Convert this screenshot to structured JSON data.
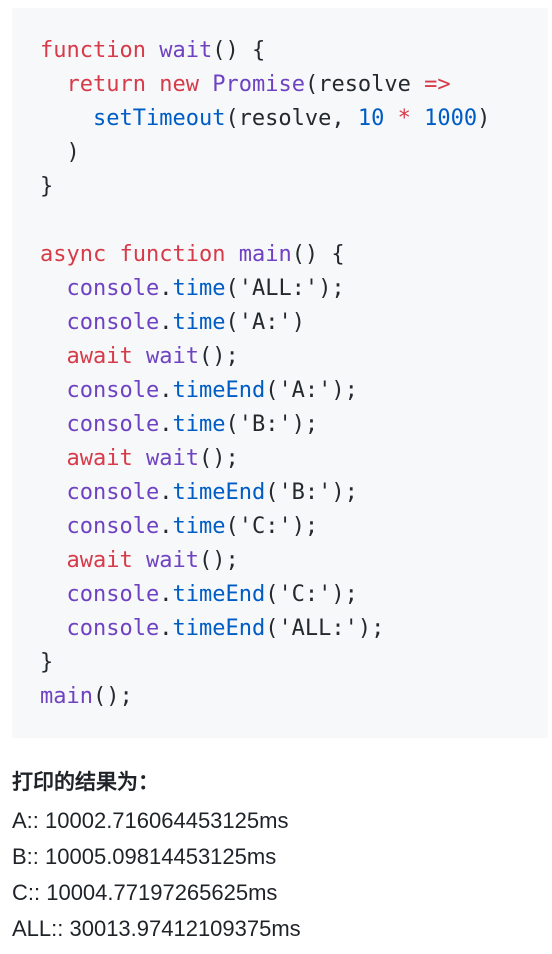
{
  "code": {
    "lines": [
      [
        [
          "kw",
          "function"
        ],
        [
          "plain",
          " "
        ],
        [
          "fn",
          "wait"
        ],
        [
          "plain",
          "() {"
        ]
      ],
      [
        [
          "plain",
          "  "
        ],
        [
          "kw",
          "return"
        ],
        [
          "plain",
          " "
        ],
        [
          "kw",
          "new"
        ],
        [
          "plain",
          " "
        ],
        [
          "fn",
          "Promise"
        ],
        [
          "plain",
          "(resolve "
        ],
        [
          "kw",
          "=>"
        ]
      ],
      [
        [
          "plain",
          "    "
        ],
        [
          "prop",
          "setTimeout"
        ],
        [
          "plain",
          "(resolve, "
        ],
        [
          "num",
          "10"
        ],
        [
          "plain",
          " "
        ],
        [
          "kw",
          "*"
        ],
        [
          "plain",
          " "
        ],
        [
          "num",
          "1000"
        ],
        [
          "plain",
          ")"
        ]
      ],
      [
        [
          "plain",
          "  )"
        ]
      ],
      [
        [
          "plain",
          "}"
        ]
      ],
      [],
      [
        [
          "kw",
          "async"
        ],
        [
          "plain",
          " "
        ],
        [
          "kw",
          "function"
        ],
        [
          "plain",
          " "
        ],
        [
          "fn",
          "main"
        ],
        [
          "plain",
          "() {"
        ]
      ],
      [
        [
          "plain",
          "  "
        ],
        [
          "obj",
          "console"
        ],
        [
          "plain",
          "."
        ],
        [
          "prop",
          "time"
        ],
        [
          "plain",
          "("
        ],
        [
          "str",
          "'ALL:'"
        ],
        [
          "plain",
          ");"
        ]
      ],
      [
        [
          "plain",
          "  "
        ],
        [
          "obj",
          "console"
        ],
        [
          "plain",
          "."
        ],
        [
          "prop",
          "time"
        ],
        [
          "plain",
          "("
        ],
        [
          "str",
          "'A:'"
        ],
        [
          "plain",
          ")"
        ]
      ],
      [
        [
          "plain",
          "  "
        ],
        [
          "kw",
          "await"
        ],
        [
          "plain",
          " "
        ],
        [
          "fn",
          "wait"
        ],
        [
          "plain",
          "();"
        ]
      ],
      [
        [
          "plain",
          "  "
        ],
        [
          "obj",
          "console"
        ],
        [
          "plain",
          "."
        ],
        [
          "prop",
          "timeEnd"
        ],
        [
          "plain",
          "("
        ],
        [
          "str",
          "'A:'"
        ],
        [
          "plain",
          ");"
        ]
      ],
      [
        [
          "plain",
          "  "
        ],
        [
          "obj",
          "console"
        ],
        [
          "plain",
          "."
        ],
        [
          "prop",
          "time"
        ],
        [
          "plain",
          "("
        ],
        [
          "str",
          "'B:'"
        ],
        [
          "plain",
          ");"
        ]
      ],
      [
        [
          "plain",
          "  "
        ],
        [
          "kw",
          "await"
        ],
        [
          "plain",
          " "
        ],
        [
          "fn",
          "wait"
        ],
        [
          "plain",
          "();"
        ]
      ],
      [
        [
          "plain",
          "  "
        ],
        [
          "obj",
          "console"
        ],
        [
          "plain",
          "."
        ],
        [
          "prop",
          "timeEnd"
        ],
        [
          "plain",
          "("
        ],
        [
          "str",
          "'B:'"
        ],
        [
          "plain",
          ");"
        ]
      ],
      [
        [
          "plain",
          "  "
        ],
        [
          "obj",
          "console"
        ],
        [
          "plain",
          "."
        ],
        [
          "prop",
          "time"
        ],
        [
          "plain",
          "("
        ],
        [
          "str",
          "'C:'"
        ],
        [
          "plain",
          ");"
        ]
      ],
      [
        [
          "plain",
          "  "
        ],
        [
          "kw",
          "await"
        ],
        [
          "plain",
          " "
        ],
        [
          "fn",
          "wait"
        ],
        [
          "plain",
          "();"
        ]
      ],
      [
        [
          "plain",
          "  "
        ],
        [
          "obj",
          "console"
        ],
        [
          "plain",
          "."
        ],
        [
          "prop",
          "timeEnd"
        ],
        [
          "plain",
          "("
        ],
        [
          "str",
          "'C:'"
        ],
        [
          "plain",
          ");"
        ]
      ],
      [
        [
          "plain",
          "  "
        ],
        [
          "obj",
          "console"
        ],
        [
          "plain",
          "."
        ],
        [
          "prop",
          "timeEnd"
        ],
        [
          "plain",
          "("
        ],
        [
          "str",
          "'ALL:'"
        ],
        [
          "plain",
          ");"
        ]
      ],
      [
        [
          "plain",
          "}"
        ]
      ],
      [
        [
          "fn",
          "main"
        ],
        [
          "plain",
          "();"
        ]
      ]
    ]
  },
  "results": {
    "heading": "打印的结果为：",
    "lines": [
      "A:: 10002.716064453125ms",
      "B:: 10005.09814453125ms",
      "C:: 10004.77197265625ms",
      "ALL:: 30013.97412109375ms"
    ]
  },
  "colors": {
    "keyword": "#d73a49",
    "function": "#6f42c1",
    "property": "#005cc5",
    "number": "#005cc5",
    "text": "#24292e",
    "code_background": "#f6f8fa"
  }
}
